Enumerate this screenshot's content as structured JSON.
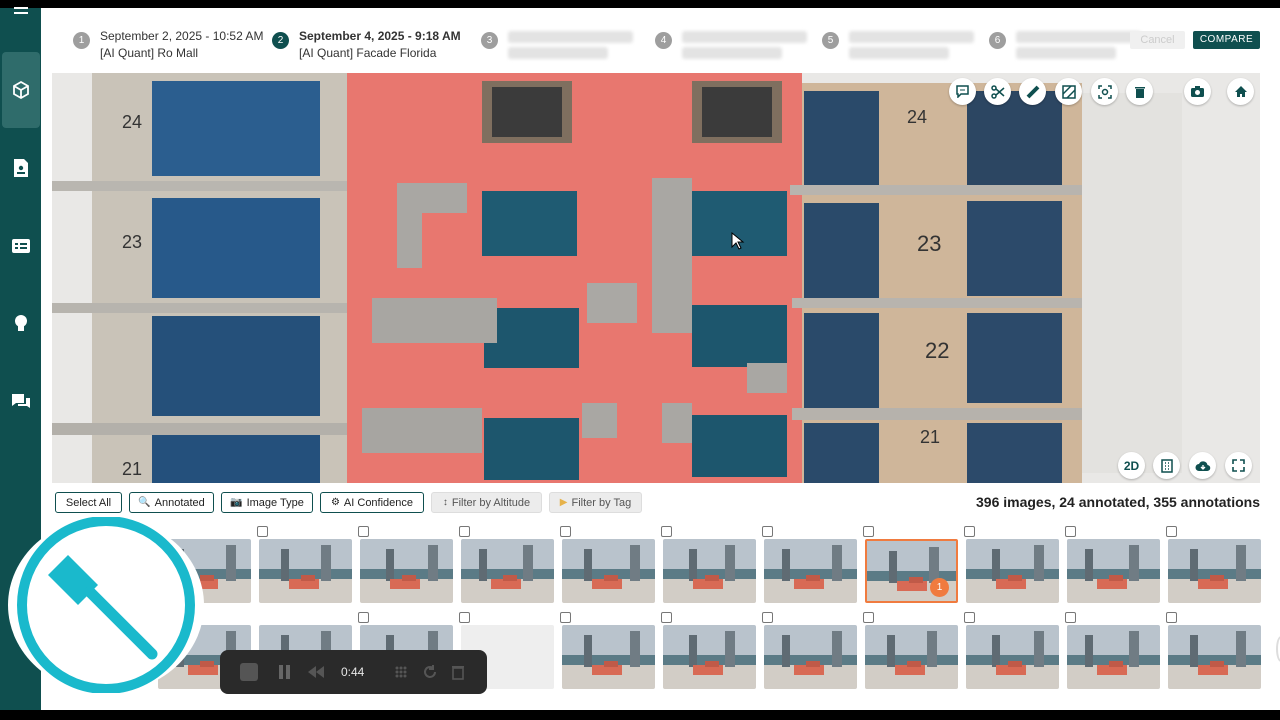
{
  "steps": [
    {
      "num": "1",
      "date": "September 2, 2025 - 10:52 AM",
      "name": "[AI Quant] Ro Mall",
      "active": false
    },
    {
      "num": "2",
      "date": "September 4, 2025 - 9:18 AM",
      "name": "[AI Quant] Facade Florida",
      "active": true
    },
    {
      "num": "3"
    },
    {
      "num": "4"
    },
    {
      "num": "5"
    },
    {
      "num": "6"
    }
  ],
  "header": {
    "cancel_label": "Cancel",
    "compare_label": "COMPARE"
  },
  "viewer": {
    "floor_labels": [
      "24",
      "23",
      "22",
      "21"
    ],
    "view_toggle_label": "2D",
    "tools_top": [
      "comment-icon",
      "scissors-icon",
      "ruler-icon",
      "hatch-icon",
      "scan-icon",
      "trash-icon",
      "camera-icon",
      "home-icon"
    ],
    "tools_bottom": [
      "2d-toggle",
      "building-icon",
      "cloud-download-icon",
      "fullscreen-icon"
    ]
  },
  "filters": {
    "select_all": "Select All",
    "annotated": "Annotated",
    "image_type": "Image Type",
    "ai_confidence": "AI Confidence",
    "filter_altitude": "Filter by Altitude",
    "filter_tag": "Filter by Tag"
  },
  "summary": "396 images, 24 annotated, 355 annotations",
  "thumbnails": {
    "selected_badge": "1"
  },
  "recorder": {
    "time": "0:44"
  },
  "colors": {
    "brand": "#0f4f4f",
    "accent": "#f07b3f",
    "logo": "#1ab9cc"
  }
}
